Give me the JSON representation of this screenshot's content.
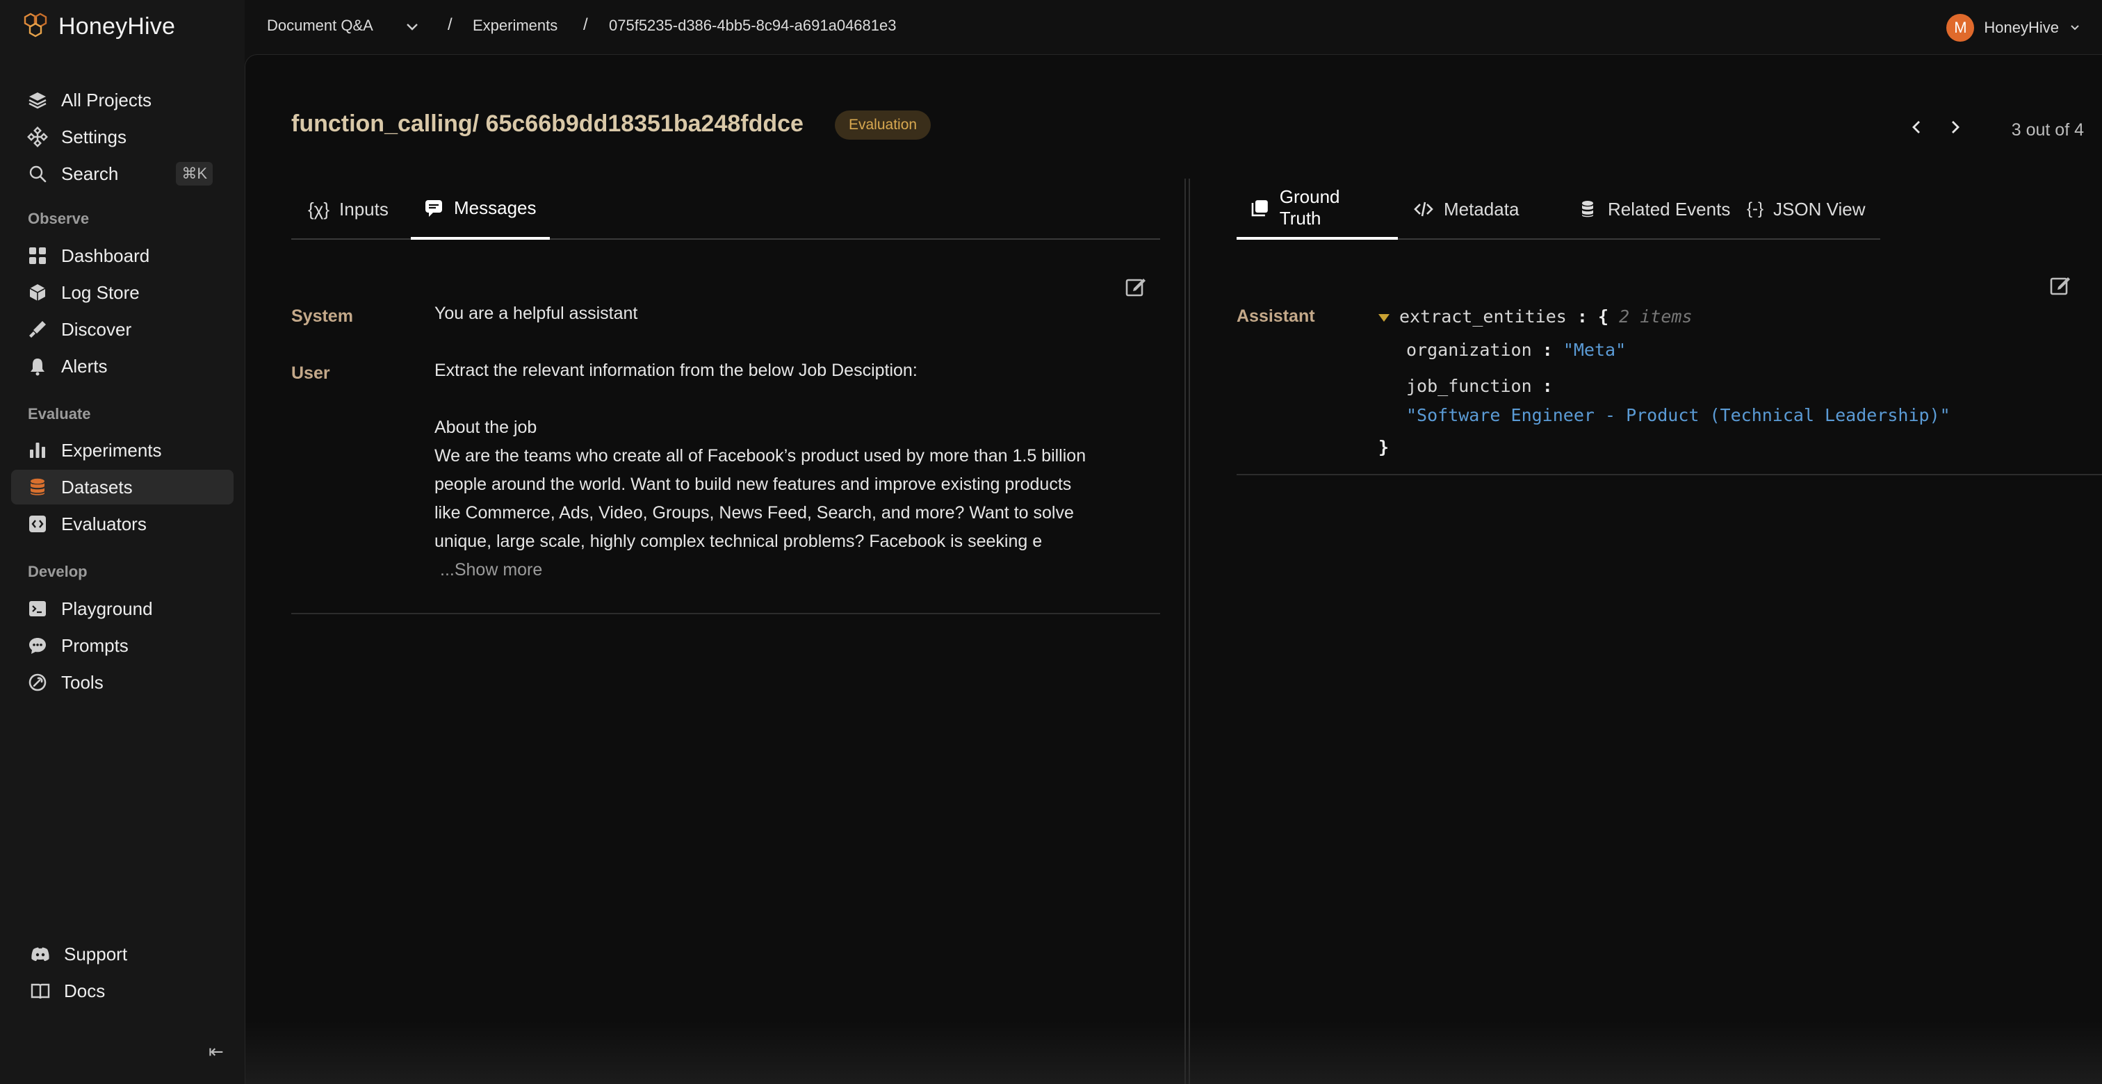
{
  "app": {
    "name": "HoneyHive"
  },
  "sidebar": {
    "top_items": [
      {
        "label": "All Projects",
        "icon": "layers-icon"
      },
      {
        "label": "Settings",
        "icon": "settings-icon"
      },
      {
        "label": "Search",
        "icon": "search-icon",
        "shortcut": "⌘K"
      }
    ],
    "sections": {
      "observe": "Observe",
      "evaluate": "Evaluate",
      "develop": "Develop"
    },
    "observe_items": [
      {
        "label": "Dashboard",
        "icon": "dashboard-icon"
      },
      {
        "label": "Log Store",
        "icon": "log-store-icon"
      },
      {
        "label": "Discover",
        "icon": "discover-icon"
      },
      {
        "label": "Alerts",
        "icon": "bell-icon"
      }
    ],
    "evaluate_items": [
      {
        "label": "Experiments",
        "icon": "bar-chart-icon"
      },
      {
        "label": "Datasets",
        "icon": "database-icon",
        "active": true
      },
      {
        "label": "Evaluators",
        "icon": "code-box-icon"
      }
    ],
    "develop_items": [
      {
        "label": "Playground",
        "icon": "terminal-icon"
      },
      {
        "label": "Prompts",
        "icon": "chat-bubble-icon"
      },
      {
        "label": "Tools",
        "icon": "wrench-icon"
      }
    ],
    "footer_items": [
      {
        "label": "Support",
        "icon": "discord-icon"
      },
      {
        "label": "Docs",
        "icon": "book-icon"
      }
    ]
  },
  "breadcrumb": {
    "project": "Document Q&A",
    "section": "Experiments",
    "run_id": "075f5235-d386-4bb5-8c94-a691a04681e3",
    "sep": "/"
  },
  "user": {
    "initial": "M",
    "name": "HoneyHive"
  },
  "header": {
    "title": "function_calling/ 65c66b9dd18351ba248fddce",
    "badge": "Evaluation",
    "pager": "3 out of 4"
  },
  "left_tabs": [
    {
      "label": "Inputs",
      "icon": "variable-icon"
    },
    {
      "label": "Messages",
      "icon": "message-icon",
      "active": true
    }
  ],
  "messages": [
    {
      "role": "System",
      "content": "You are a helpful assistant"
    },
    {
      "role": "User",
      "lines": [
        "Extract the relevant information from the below Job Desciption:",
        "",
        "About the job",
        "We are the teams who create all of Facebook’s product used by more than 1.5 billion",
        "people around the world. Want to build new features and improve existing products",
        "like Commerce, Ads, Video, Groups, News Feed, Search, and more? Want to solve",
        "unique, large scale, highly complex technical problems? Facebook is seeking e"
      ],
      "show_more": "...Show more"
    }
  ],
  "right_tabs": [
    {
      "label": "Ground Truth",
      "icon": "stack-icon",
      "active": true
    },
    {
      "label": "Metadata",
      "icon": "code-icon"
    },
    {
      "label": "Related Events",
      "icon": "database-icon"
    },
    {
      "label": "JSON View",
      "icon": "braces-icon"
    }
  ],
  "ground_truth": {
    "role": "Assistant",
    "root_key": "extract_entities",
    "root_count": "2 items",
    "open_brace": "{",
    "close_brace": "}",
    "colon": ":",
    "fields": [
      {
        "key": "organization",
        "value": "\"Meta\""
      },
      {
        "key": "job_function",
        "value": "\"Software Engineer - Product (Technical Leadership)\""
      }
    ]
  },
  "colors": {
    "accent": "#e06a2c",
    "badge_text": "#d8a850",
    "json_string": "#5b9bd5",
    "role_label": "#c4a98a"
  }
}
